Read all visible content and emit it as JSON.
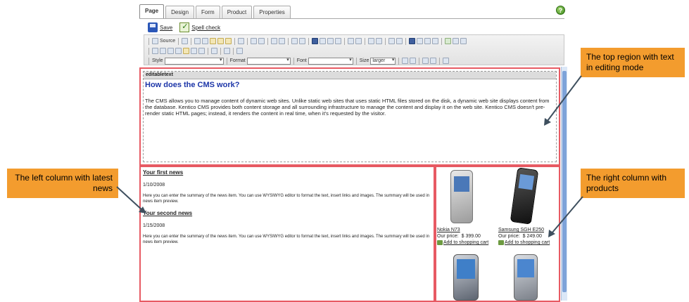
{
  "tabs": [
    "Page",
    "Design",
    "Form",
    "Product",
    "Properties"
  ],
  "help_icon": "?",
  "actions": {
    "save": "Save",
    "spell_check": "Spell check"
  },
  "toolbar": {
    "source": "Source",
    "style_label": "Style",
    "format_label": "Format",
    "font_label": "Font",
    "size_label": "Size",
    "size_value": "larger"
  },
  "editable_label": "editabletext",
  "editable_title": "How does the CMS work?",
  "editable_body": "The CMS allows you to manage content of dynamic web sites. Unlike static web sites that uses static HTML files stored on the disk, a dynamic web site displays content from the database. Kentico CMS provides both content storage and all surrounding infrastructure to manage the content and display it on the web site. Kentico CMS doesn't pre-render static HTML pages; instead, it renders the content in real time, when it's requested by the visitor.",
  "news": [
    {
      "title": "Your first news",
      "date": "1/10/2008",
      "summary": "Here you can enter the summary of the news item. You can use WYSIWYG editor to format the text, insert links and images. The summary will be used in news item preview."
    },
    {
      "title": "Your second news",
      "date": "1/15/2008",
      "summary": "Here you can enter the summary of the news item. You can use WYSIWYG editor to format the text, insert links and images. The summary will be used in news item preview."
    }
  ],
  "products": [
    {
      "name": "Nokia N73",
      "price_label": "Our price:",
      "price": "$ 399.00",
      "cart": "Add to shopping cart"
    },
    {
      "name": "Samsung SGH E250",
      "price_label": "Our price:",
      "price": "$ 249.00",
      "cart": "Add to shopping cart"
    }
  ],
  "callouts": {
    "top": "The top region with text in editing mode",
    "left": "The left column with latest news",
    "right": "The right column with products"
  },
  "colors": {
    "region_border": "#e75a63",
    "callout_bg": "#f39c2e",
    "title_blue": "#1c35a8"
  }
}
